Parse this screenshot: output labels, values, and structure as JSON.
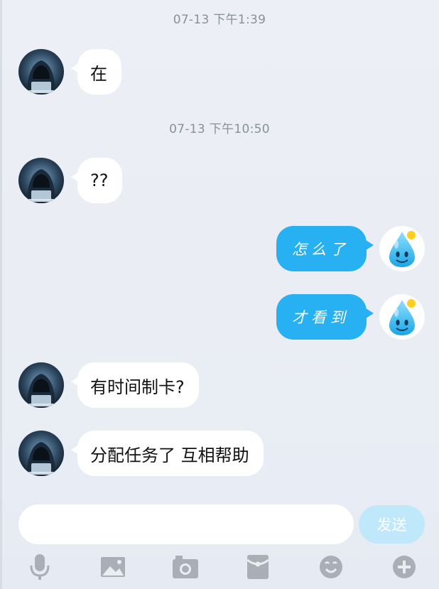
{
  "timestamps": [
    "07-13 下午1:39",
    "07-13 下午10:50"
  ],
  "messages": [
    {
      "side": "left",
      "text": "在"
    },
    {
      "side": "left",
      "text": "??"
    },
    {
      "side": "right",
      "text": "怎么了"
    },
    {
      "side": "right",
      "text": "才看到"
    },
    {
      "side": "left",
      "text": "有时间制卡?"
    },
    {
      "side": "left",
      "text": "分配任务了 互相帮助"
    }
  ],
  "composer": {
    "input_value": "",
    "send_label": "发送"
  },
  "toolbar": {
    "icons": [
      "microphone-icon",
      "image-icon",
      "camera-icon",
      "red-packet-icon",
      "emoji-icon",
      "plus-icon"
    ]
  },
  "colors": {
    "background": "#ebeef4",
    "bubble_mine": "#27b0f2",
    "bubble_theirs": "#ffffff",
    "send_button": "#bfe8fb",
    "toolbar_icon": "#a9aeb7"
  }
}
